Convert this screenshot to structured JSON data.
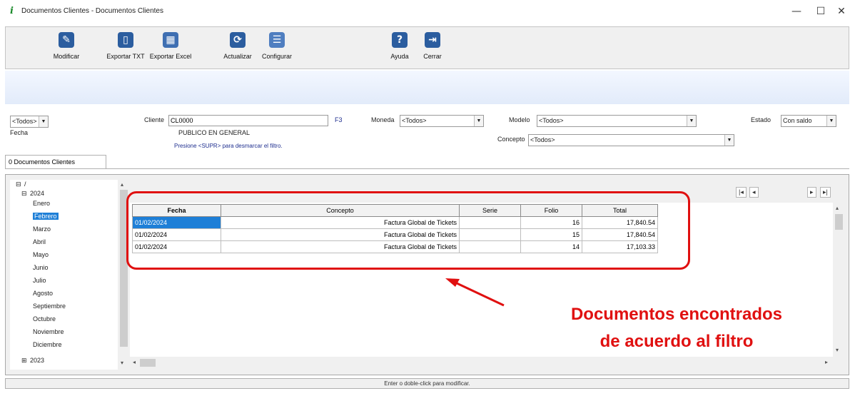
{
  "window": {
    "title": "Documentos Clientes - Documentos Clientes",
    "minimize": "—",
    "maximize": "☐",
    "close": "✕"
  },
  "toolbar": {
    "buttons": [
      {
        "label": "Modificar",
        "icon": "edit-icon"
      },
      {
        "label": "Exportar TXT",
        "icon": "export-txt-icon"
      },
      {
        "label": "Exportar Excel",
        "icon": "export-excel-icon"
      },
      {
        "label": "Actualizar",
        "icon": "refresh-icon"
      },
      {
        "label": "Configurar",
        "icon": "configure-icon"
      },
      {
        "label": "Ayuda",
        "icon": "help-icon"
      },
      {
        "label": "Cerrar",
        "icon": "close-door-icon"
      }
    ]
  },
  "filters": {
    "fecha_combo": "<Todos>",
    "fecha_label": "Fecha",
    "cliente_label": "Cliente",
    "cliente_value": "CL0000",
    "cliente_button": "F3",
    "cliente_name": "PUBLICO EN GENERAL",
    "hint": "Presione <SUPR> para desmarcar el filtro.",
    "moneda_label": "Moneda",
    "moneda_value": "<Todos>",
    "modelo_label": "Modelo",
    "modelo_value": "<Todos>",
    "concepto_label": "Concepto",
    "concepto_value": "<Todos>",
    "estado_label": "Estado",
    "estado_value": "Con saldo"
  },
  "tabs": {
    "active": "0 Documentos Clientes"
  },
  "tree": {
    "root": "/",
    "year": "2024",
    "months": [
      "Enero",
      "Febrero",
      "Marzo",
      "Abril",
      "Mayo",
      "Junio",
      "Julio",
      "Agosto",
      "Septiembre",
      "Octubre",
      "Noviembre",
      "Diciembre"
    ],
    "selected_month": "Febrero",
    "other_year": "2023"
  },
  "grid": {
    "columns": [
      "Fecha",
      "Concepto",
      "Serie",
      "Folio",
      "Total"
    ],
    "rows": [
      {
        "fecha": "01/02/2024",
        "concepto": "Factura Global de Tickets",
        "serie": "",
        "folio": "16",
        "total": "17,840.54"
      },
      {
        "fecha": "01/02/2024",
        "concepto": "Factura Global de Tickets",
        "serie": "",
        "folio": "15",
        "total": "17,840.54"
      },
      {
        "fecha": "01/02/2024",
        "concepto": "Factura Global de Tickets",
        "serie": "",
        "folio": "14",
        "total": "17,103.33"
      }
    ]
  },
  "nav": {
    "first": "|◂",
    "prev": "◂",
    "next": "▸",
    "last": "▸|"
  },
  "annotation": {
    "line1": "Documentos encontrados",
    "line2": "de acuerdo al filtro"
  },
  "status": "Enter o doble-click para modificar.",
  "colors": {
    "accent": "#e01010",
    "selection": "#1e7fd7"
  }
}
